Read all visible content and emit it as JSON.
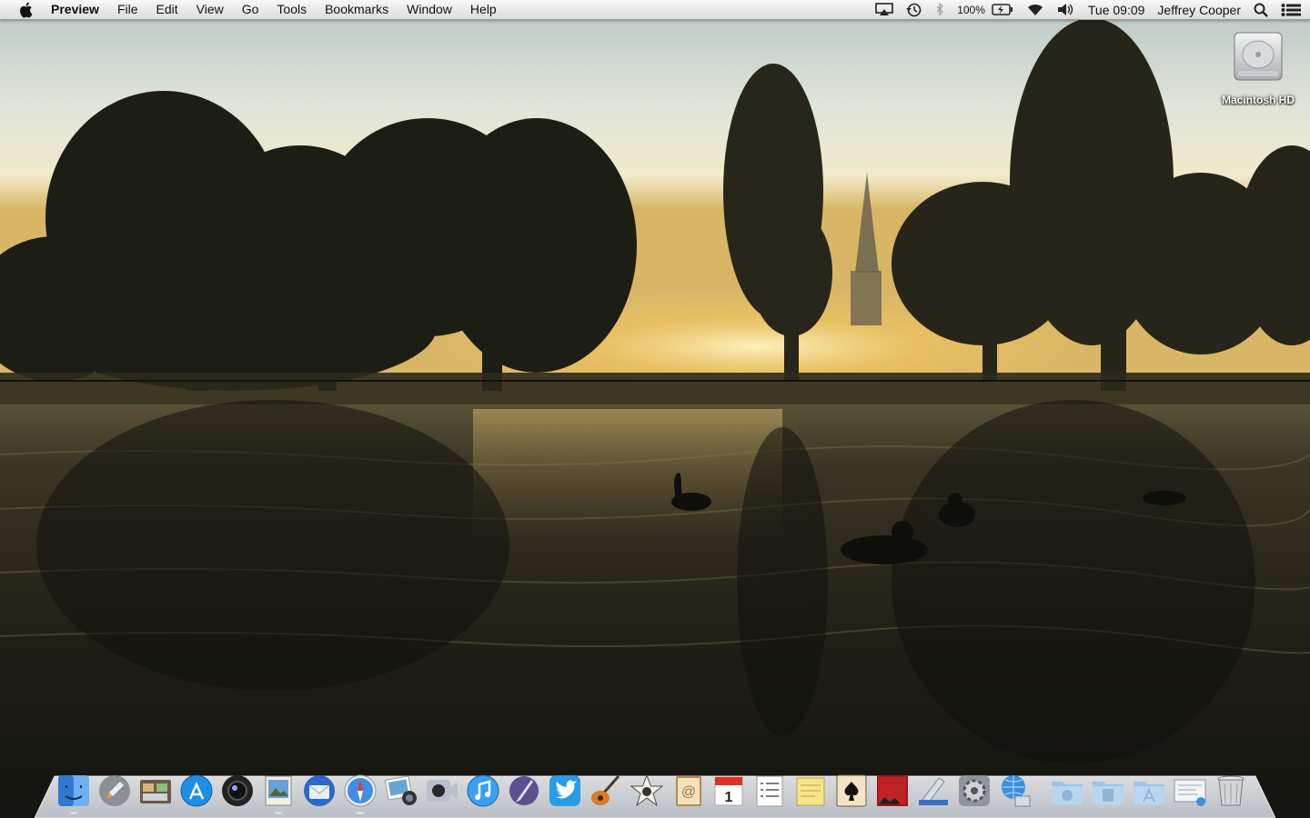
{
  "menubar": {
    "app_name": "Preview",
    "menus": [
      "File",
      "Edit",
      "View",
      "Go",
      "Tools",
      "Bookmarks",
      "Window",
      "Help"
    ],
    "status": {
      "battery_percent": "100%",
      "clock": "Tue 09:09",
      "user": "Jeffrey Cooper"
    },
    "status_icons": [
      "airplay-icon",
      "time-machine-icon",
      "bluetooth-icon",
      "battery-icon",
      "wifi-icon",
      "volume-icon",
      "spotlight-icon",
      "notification-center-icon"
    ]
  },
  "desktop": {
    "drive_label": "Macintosh HD"
  },
  "dock": {
    "apps": [
      "finder-icon",
      "launchpad-icon",
      "image-capture-icon",
      "app-store-icon",
      "photo-booth-icon",
      "preview-icon",
      "thunderbird-icon",
      "safari-icon",
      "iphoto-icon",
      "facetime-icon",
      "itunes-icon",
      "pen-tool-icon",
      "twitter-icon",
      "garageband-icon",
      "imovie-icon",
      "address-book-icon",
      "ical-icon",
      "reminders-icon",
      "stickies-icon",
      "solitaire-icon",
      "photo-slideshow-icon",
      "preview-scanner-icon",
      "system-preferences-icon",
      "network-utility-icon"
    ],
    "stacks": [
      "documents-folder-icon",
      "downloads-folder-icon",
      "applications-folder-icon",
      "mail-document-icon",
      "trash-icon"
    ],
    "colors": {
      "shelf": "#d9dde3",
      "accent": "#1e8fe8"
    }
  }
}
